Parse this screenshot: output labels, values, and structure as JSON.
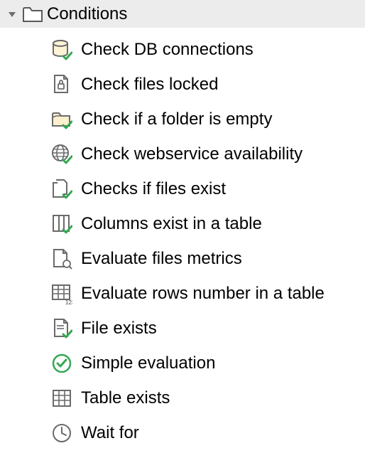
{
  "header": {
    "label": "Conditions"
  },
  "items": [
    {
      "label": "Check DB connections",
      "icon": "db-check-icon"
    },
    {
      "label": "Check files locked",
      "icon": "file-lock-icon"
    },
    {
      "label": "Check if a folder is empty",
      "icon": "folder-check-icon"
    },
    {
      "label": "Check webservice availability",
      "icon": "globe-check-icon"
    },
    {
      "label": "Checks if files exist",
      "icon": "files-check-icon"
    },
    {
      "label": "Columns exist in a table",
      "icon": "columns-check-icon"
    },
    {
      "label": "Evaluate files metrics",
      "icon": "file-metrics-icon"
    },
    {
      "label": "Evaluate rows number in a table",
      "icon": "table-rows-icon"
    },
    {
      "label": "File exists",
      "icon": "file-check-icon"
    },
    {
      "label": "Simple evaluation",
      "icon": "circle-check-icon"
    },
    {
      "label": "Table exists",
      "icon": "table-icon"
    },
    {
      "label": "Wait for",
      "icon": "clock-icon"
    }
  ]
}
